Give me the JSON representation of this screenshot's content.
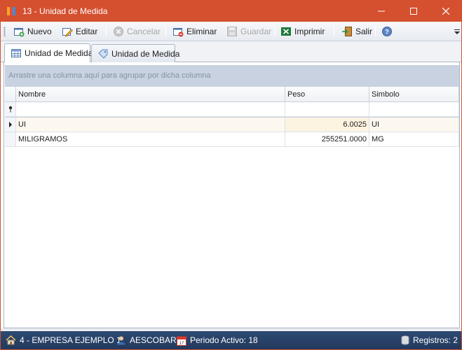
{
  "window": {
    "title": "13 - Unidad de Medida",
    "icon": "app-color-bars-icon",
    "title_bar_color": "#d4502f"
  },
  "toolbar": {
    "items": [
      {
        "label": "Nuevo",
        "icon": "new-document-icon",
        "enabled": true
      },
      {
        "label": "Editar",
        "icon": "edit-pencil-icon",
        "enabled": true
      },
      {
        "label": "Cancelar",
        "icon": "cancel-circle-icon",
        "enabled": false
      },
      {
        "label": "Eliminar",
        "icon": "delete-document-icon",
        "enabled": true
      },
      {
        "label": "Guardar",
        "icon": "save-disk-icon",
        "enabled": false
      },
      {
        "label": "Imprimir",
        "icon": "excel-print-icon",
        "enabled": true
      },
      {
        "label": "Salir",
        "icon": "exit-door-icon",
        "enabled": true
      }
    ],
    "help_icon": "help-icon"
  },
  "tabs": [
    {
      "label": "Unidad de Medida",
      "icon": "table-icon",
      "active": true
    },
    {
      "label": "Unidad de Medida",
      "icon": "tag-icon",
      "active": false
    }
  ],
  "grid": {
    "group_panel_text": "Arrastre una columna aquí para agrupar por dicha columna",
    "columns": [
      "Nombre",
      "Peso",
      "Simbolo"
    ],
    "filter_row_icon": "pin-icon",
    "rows": [
      {
        "nombre": "UI",
        "peso": "6.0025",
        "simbolo": "UI",
        "selected": true
      },
      {
        "nombre": "MILIGRAMOS",
        "peso": "255251.0000",
        "simbolo": "MG",
        "selected": false
      }
    ]
  },
  "statusbar": {
    "company": "4 - EMPRESA EJEMPLO 1",
    "user": "AESCOBAR",
    "period": "Periodo Activo: 18",
    "records": "Registros: 2",
    "company_icon": "home-icon",
    "user_icon": "user-icon",
    "period_icon": "calendar-icon",
    "records_icon": "database-icon",
    "background": "#22395c"
  }
}
